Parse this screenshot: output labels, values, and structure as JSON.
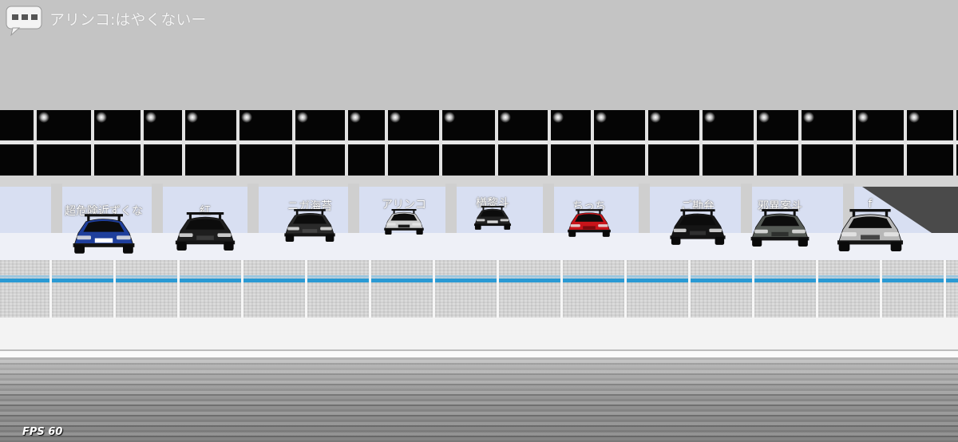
{
  "hud": {
    "chat_message": "アリンコ:はやくないー",
    "fps_label": "FPS 60"
  },
  "players": [
    {
      "name": "超危険近ずくな",
      "car_color": "#1f3f9c",
      "accent": "#ffffff"
    },
    {
      "name": "紅",
      "car_color": "#1e1e1e",
      "accent": "#3a3a3a"
    },
    {
      "name": "ニガ海苔",
      "car_color": "#2a2a2a",
      "accent": "#444444"
    },
    {
      "name": "アリンコ",
      "car_color": "#cfcfcf",
      "accent": "#1a1a1a"
    },
    {
      "name": "楢黎斗",
      "car_color": "#222222",
      "accent": "#d9d9d9"
    },
    {
      "name": "ちっち",
      "car_color": "#c8141a",
      "accent": "#7a0a0e"
    },
    {
      "name": "ご勘弁",
      "car_color": "#151515",
      "accent": "#303030"
    },
    {
      "name": "邪異案斗",
      "car_color": "#555a55",
      "accent": "#2e302e"
    },
    {
      "name": "f",
      "car_color": "#b8b8b8",
      "accent": "#444444"
    }
  ]
}
